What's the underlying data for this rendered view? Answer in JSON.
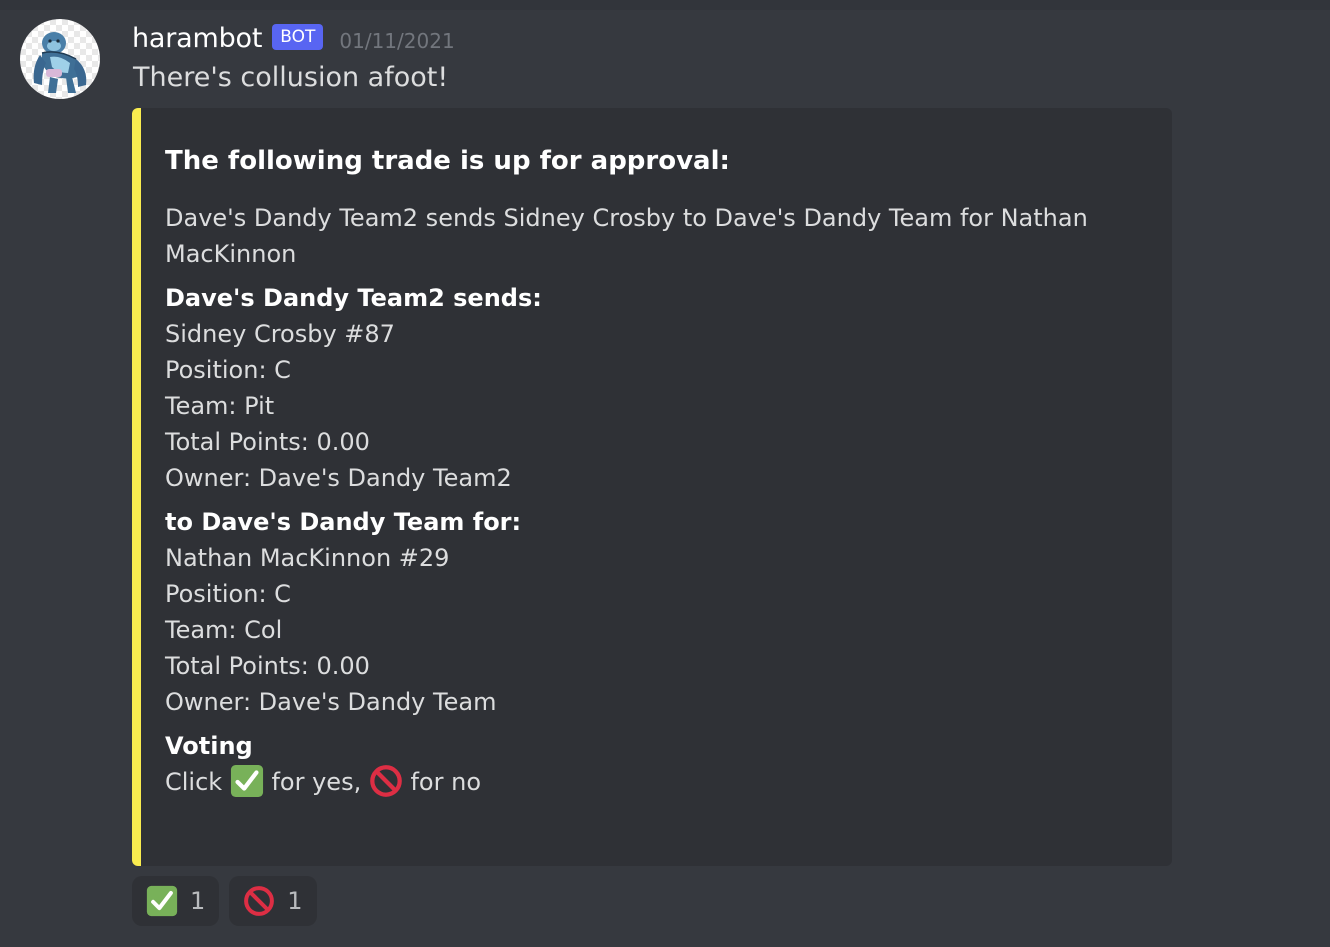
{
  "message": {
    "author": "harambot",
    "bot_tag": "BOT",
    "timestamp": "01/11/2021",
    "content": "There's collusion afoot!",
    "avatar_icon": "gorilla-avatar"
  },
  "embed": {
    "accent_color": "#f9ec4f",
    "title": "The following trade is up for approval:",
    "description": "Dave's Dandy Team2 sends Sidney Crosby to Dave's Dandy Team for Nathan MacKinnon",
    "fields": [
      {
        "name": "Dave's Dandy Team2 sends:",
        "lines": [
          "Sidney Crosby #87",
          "Position: C",
          "Team: Pit",
          "Total Points: 0.00",
          "Owner: Dave's Dandy Team2"
        ]
      },
      {
        "name": "to Dave's Dandy Team for:",
        "lines": [
          "Nathan MacKinnon #29",
          "Position: C",
          "Team: Col",
          "Total Points: 0.00",
          "Owner: Dave's Dandy Team"
        ]
      }
    ],
    "voting": {
      "name": "Voting",
      "prefix": "Click",
      "yes_text": "for yes,",
      "no_text": "for no",
      "yes_icon": "white-check-mark-icon",
      "no_icon": "no-entry-sign-icon"
    }
  },
  "reactions": [
    {
      "icon": "white-check-mark-icon",
      "count": "1"
    },
    {
      "icon": "no-entry-sign-icon",
      "count": "1"
    }
  ],
  "colors": {
    "background": "#36393f",
    "embed_background": "#2f3136",
    "bot_tag": "#5865f2",
    "check_green": "#78b159",
    "no_red": "#dd2e44"
  }
}
